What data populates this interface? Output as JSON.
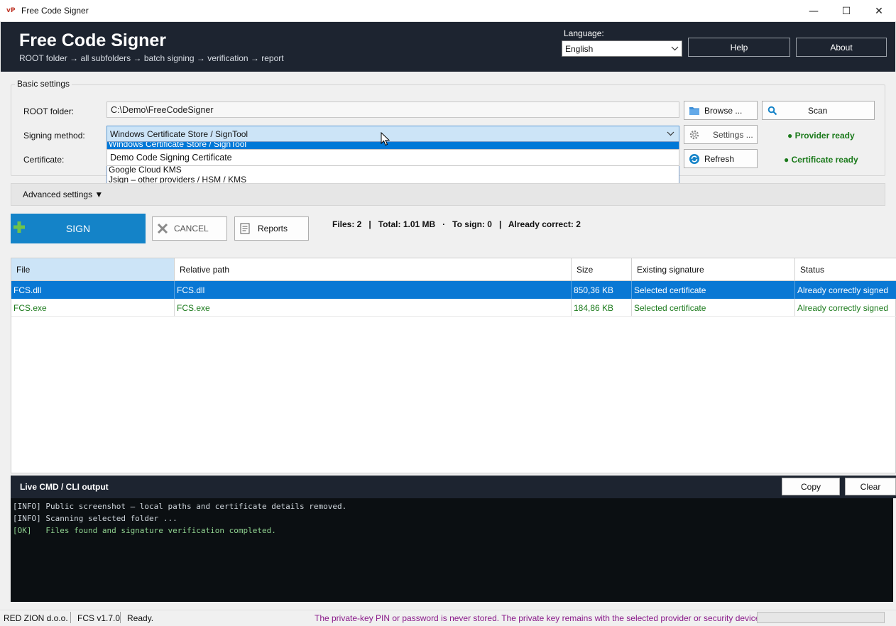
{
  "window": {
    "icon_text": "vP",
    "title": "Free Code Signer",
    "minimize": "—",
    "maximize": "☐",
    "close": "✕"
  },
  "header": {
    "title": "Free Code Signer",
    "subtitle": "ROOT folder → all subfolders → batch signing → verification → report",
    "language_label": "Language:",
    "language_value": "English",
    "help_label": "Help",
    "about_label": "About"
  },
  "basic": {
    "legend": "Basic settings",
    "root_label": "ROOT folder:",
    "root_value": "C:\\Demo\\FreeCodeSigner",
    "browse_label": "Browse ...",
    "scan_label": "Scan",
    "method_label": "Signing method:",
    "method_value": "Windows Certificate Store / SignTool",
    "settings_label": "Settings ...",
    "provider_status": "● Provider ready",
    "certificate_label": "Certificate:",
    "certificate_value": "Demo Code Signing Certificate",
    "refresh_label": "Refresh",
    "certificate_status": "● Certificate ready",
    "method_options": [
      "Windows Certificate Store / SignTool",
      "Google Cloud KMS",
      "Jsign – other providers / HSM / KMS"
    ]
  },
  "advanced": {
    "label": "Advanced settings ▼"
  },
  "actions": {
    "sign_label": "SIGN",
    "cancel_label": "CANCEL",
    "reports_label": "Reports",
    "summary": "Files: 2   |   Total: 1.01 MB   ·   To sign: 0   |   Already correct: 2"
  },
  "table": {
    "columns": [
      "File",
      "Relative path",
      "Size",
      "Existing signature",
      "Status"
    ],
    "rows": [
      {
        "file": "FCS.dll",
        "path": "FCS.dll",
        "size": "850,36 KB",
        "signature": "Selected certificate",
        "status": "Already correctly signed"
      },
      {
        "file": "FCS.exe",
        "path": "FCS.exe",
        "size": "184,86 KB",
        "signature": "Selected certificate",
        "status": "Already correctly signed"
      }
    ]
  },
  "console": {
    "title": "Live CMD / CLI output",
    "copy_label": "Copy",
    "clear_label": "Clear",
    "lines": [
      "[INFO] Public screenshot – local paths and certificate details removed.",
      "[INFO] Scanning selected folder ...",
      "[OK]   Files found and signature verification completed."
    ]
  },
  "statusbar": {
    "company": "RED ZION d.o.o.",
    "version": "FCS v1.7.0",
    "state": "Ready.",
    "notice": "The private-key PIN or password is never stored. The private key remains with the selected provider or security device."
  },
  "colors": {
    "header_bg": "#1d2430",
    "accent": "#1483c8",
    "ok_green": "#1b7a1b",
    "notice_purple": "#8a1a8a"
  }
}
